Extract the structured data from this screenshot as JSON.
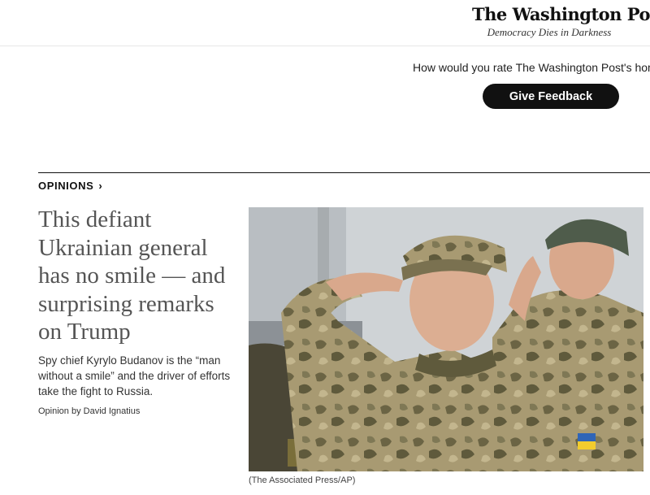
{
  "header": {
    "logo_name": "The Washington Post",
    "logo_tagline": "Democracy Dies in Darkness"
  },
  "survey": {
    "prompt": "How would you rate The Washington Post's homepage?",
    "button_label": "Give Feedback"
  },
  "section": {
    "label": "OPINIONS",
    "chevron": "›"
  },
  "article": {
    "headline": "This defiant Ukrainian general has no smile — and surprising remarks on Trump",
    "summary": "Spy chief Kyrylo Budanov is the “man without a smile” and the driver of efforts take the fight to Russia.",
    "byline": "Opinion by David Ignatius",
    "photo_caption": "(The Associated Press/AP)"
  },
  "colors": {
    "button_bg": "#111111",
    "headline": "#555555",
    "camo_light": "#a89a72",
    "camo_dark": "#5f5a3c",
    "beanie": "#4f5c4b"
  }
}
